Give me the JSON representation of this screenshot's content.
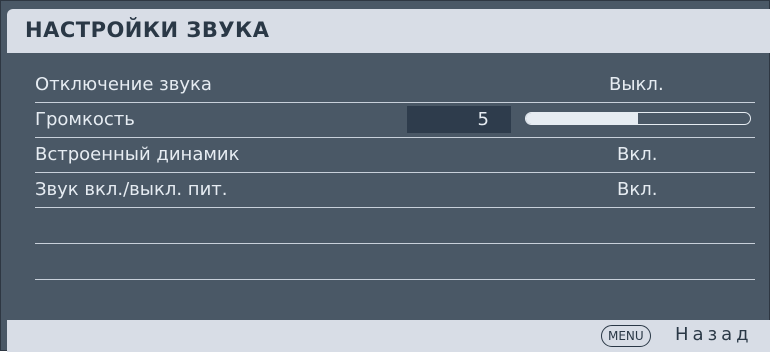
{
  "header": {
    "title": "НАСТРОЙКИ ЗВУКА"
  },
  "rows": [
    {
      "label": "Отключение звука",
      "value": "Выкл."
    },
    {
      "label": "Громкость",
      "value": "5",
      "level_fraction": 0.5
    },
    {
      "label": "Встроенный динамик",
      "value": "Вкл."
    },
    {
      "label": "Звук вкл./выкл. пит.",
      "value": "Вкл."
    }
  ],
  "footer": {
    "menu_button": "MENU",
    "back_label": "Назад"
  }
}
